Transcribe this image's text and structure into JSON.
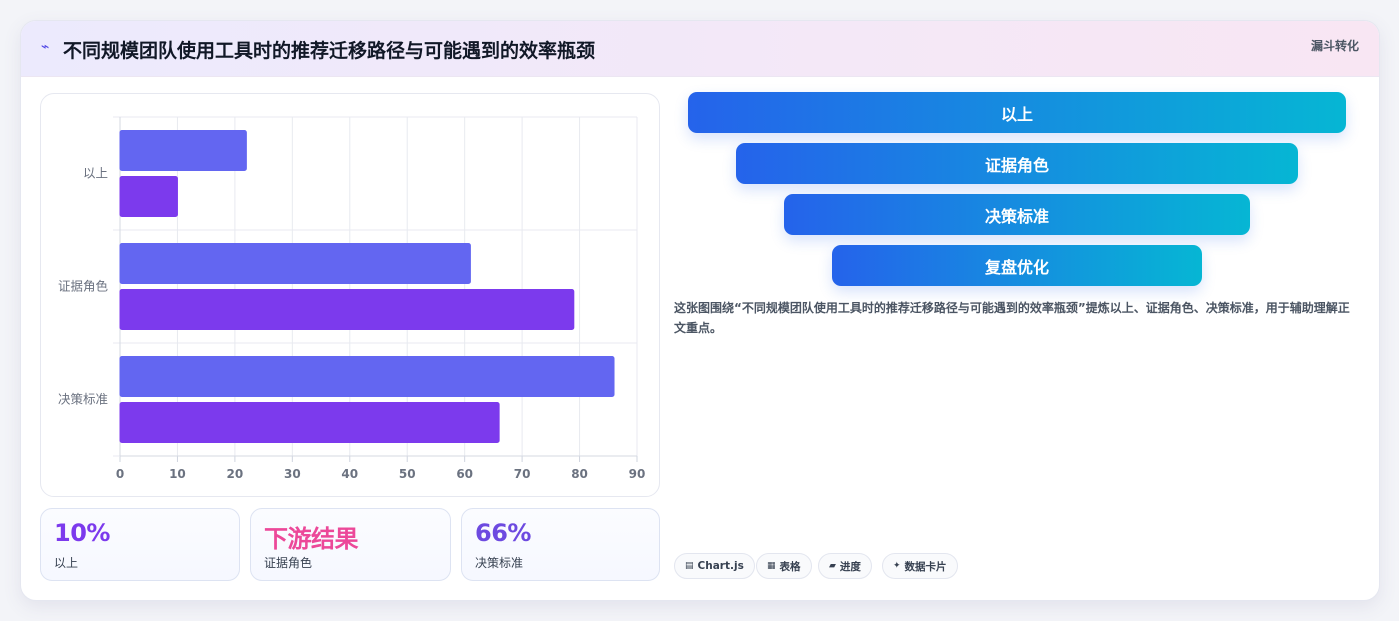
{
  "header": {
    "title": "不同规模团队使用工具时的推荐迁移路径与可能遇到的效率瓶颈",
    "tag": "漏斗转化"
  },
  "chart_data": {
    "type": "bar",
    "orientation": "horizontal",
    "categories": [
      "以上",
      "证据角色",
      "决策标准"
    ],
    "series": [
      {
        "values": [
          22,
          61,
          86
        ],
        "color": "#6366f1"
      },
      {
        "values": [
          10,
          79,
          66
        ],
        "color": "#7c3aed"
      }
    ],
    "xlim": [
      0,
      90
    ],
    "xticks": [
      0,
      10,
      20,
      30,
      40,
      50,
      60,
      70,
      80,
      90
    ],
    "grid": true,
    "legend": "none"
  },
  "stats": [
    {
      "value": "10%",
      "label": "以上",
      "color": "#7c3aed"
    },
    {
      "value": "下游结果",
      "label": "证据角色",
      "color": "#ec4899"
    },
    {
      "value": "66%",
      "label": "决策标准",
      "color": "#6d4ae0"
    }
  ],
  "funnel": {
    "stages": [
      "以上",
      "证据角色",
      "决策标准",
      "复盘优化"
    ]
  },
  "description": "这张图围绕“不同规模团队使用工具时的推荐迁移路径与可能遇到的效率瓶颈”提炼以上、证据角色、决策标准，用于辅助理解正文重点。",
  "chips": [
    {
      "icon": "▤",
      "label": "Chart.js"
    },
    {
      "icon": "▦",
      "label": "表格"
    },
    {
      "icon": "▰",
      "label": "进度"
    },
    {
      "icon": "✦",
      "label": "数据卡片"
    }
  ]
}
